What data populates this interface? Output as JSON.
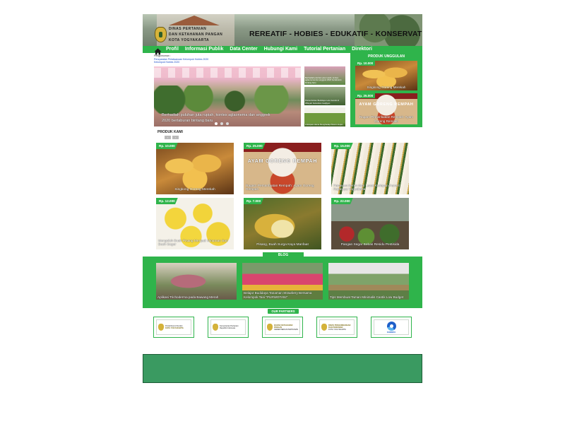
{
  "header": {
    "agency_lines": [
      "DINAS PERTANIAN",
      "DAN KETAHANAN PANGAN",
      "KOTA YOGYAKARTA"
    ],
    "tagline": "REREATIF - HOBIES - EDUKATIF - KONSERVATIF"
  },
  "nav": {
    "items": [
      "Profil",
      "Informasi Publik",
      "Data Center",
      "Hubungi Kami",
      "Tutorial Pertanian",
      "Direktori"
    ]
  },
  "announcement": {
    "title": "Pengumuman :",
    "links": [
      "Persyaratan Pelaksanaan Kelompok Hobies 2020",
      "Kelompok Hobies 2020"
    ]
  },
  "slider": {
    "caption": "Berhadiah puluhan juta rupiah, kontes aglaonema dan anggrek 2020 bertaburan bintang  baru"
  },
  "thumbnails": [
    {
      "caption": "Berhadiah puluhan juta rupiah, kontes aglaonema dan anggrek 2020 bertaburan bintang baru"
    },
    {
      "caption": "Pertumbuhan Budidaya Lele Cendol di Wilayah Kelurahan Gadjiyan"
    },
    {
      "caption": "Antisipasi Hama Menghadapi Musim Hujan"
    }
  ],
  "unggulan": {
    "title": "PRODUK UNGGULAN",
    "items": [
      {
        "price": "Rp. 10.000",
        "caption": "Singkong Goreng Merekah"
      },
      {
        "price": "Rp. 25.000",
        "caption": "Ragam Pemanfaatan Rempah: Ayam Goreng Rempah",
        "overlay": "AYAM GORENG REMPAH"
      }
    ]
  },
  "produk": {
    "title": "PRODUK KAMI",
    "arrows": [
      "‹",
      "›"
    ],
    "items": [
      {
        "price": "Rp. 10.000",
        "caption": "Singkong Goreng Merekah"
      },
      {
        "price": "Rp. 25.000",
        "caption": "Ragam Pemanfaatan Rempah: Ayam Goreng Rempah",
        "overlay": "AYAM GORENG REMPAH"
      },
      {
        "price": "Rp. 15.000",
        "caption": "Penawan Keren Nan Lezat Kudapan Favorit Rajanaya Yogyakarta"
      },
      {
        "price": "Rp. 12.000",
        "caption": "Mengolah Buah Pisang Menjadi Minuman Sari Buah Segar"
      },
      {
        "price": "Rp. 7.000",
        "caption": "Pisang, Buah Surga Kaya Manfaat"
      },
      {
        "price": "Rp. 22.000",
        "caption": "Pangan Segar Bebas Residu Pestisida"
      }
    ]
  },
  "blog": {
    "title": "BLOG",
    "items": [
      {
        "caption": "Aplikasi Trichoderma pada Bawang Merah"
      },
      {
        "caption": "Belajar Budidaya Tanaman Strawbery Bersama Kelompok Tani \"PURWOTANI\""
      },
      {
        "caption": "Tips Membuat Taman Minimalis Cantik Low Budget"
      }
    ]
  },
  "partners": {
    "title": "OUR PARTNERS",
    "items": [
      {
        "line1": "Portal Resmi Pemkot",
        "line2": "KOTA YOGYAKARTA"
      },
      {
        "line1": "Kementerian Pertanian",
        "line2": "Republik Indonesia"
      },
      {
        "line1": "BADAN KETAHANAN PANGAN",
        "line2": "KEMENTERIAN PERTANIAN"
      },
      {
        "line1": "DINAS PENGEMBANGAN DAN PERIZINAN",
        "line2": "KOTA YOGYAKARTA"
      },
      {
        "line1": "KOMINFO",
        "line2": ""
      }
    ]
  },
  "colors": {
    "brand_green": "#2fb44b",
    "footer_green": "#3a9a61",
    "link_blue": "#1f4fc9"
  }
}
